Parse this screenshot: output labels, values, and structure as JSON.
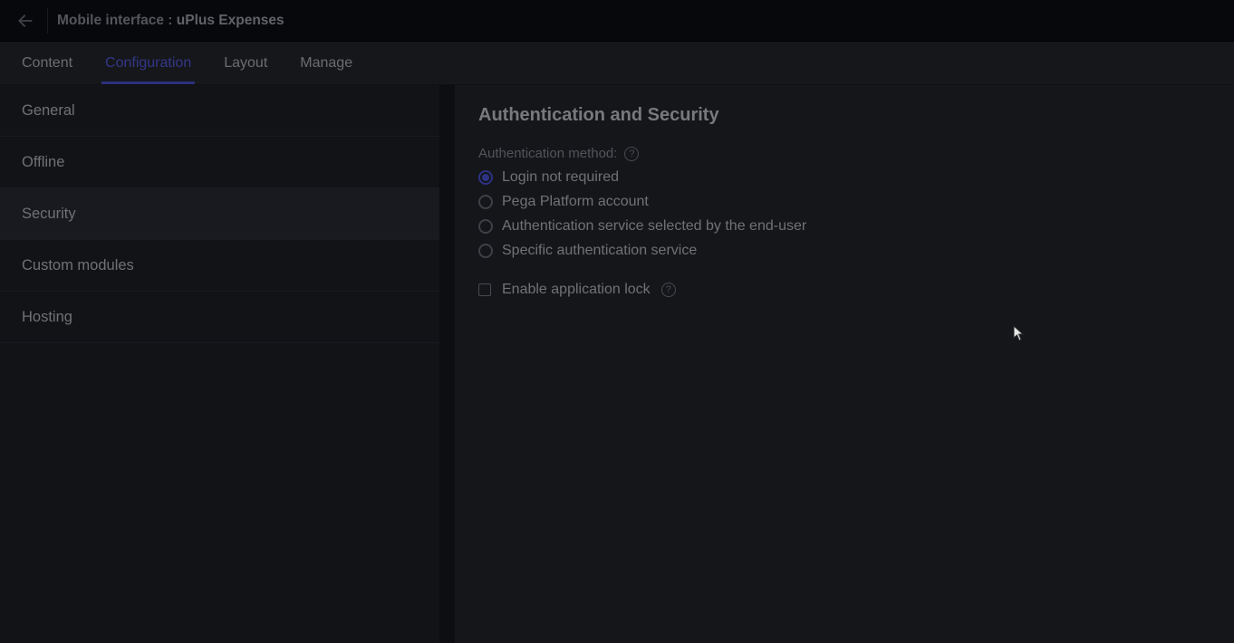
{
  "header": {
    "title_prefix": "Mobile interface :",
    "title_name": "uPlus Expenses"
  },
  "tabs": [
    {
      "label": "Content",
      "active": false
    },
    {
      "label": "Configuration",
      "active": true
    },
    {
      "label": "Layout",
      "active": false
    },
    {
      "label": "Manage",
      "active": false
    }
  ],
  "sidebar": {
    "items": [
      {
        "label": "General",
        "active": false
      },
      {
        "label": "Offline",
        "active": false
      },
      {
        "label": "Security",
        "active": true
      },
      {
        "label": "Custom modules",
        "active": false
      },
      {
        "label": "Hosting",
        "active": false
      }
    ]
  },
  "panel": {
    "title": "Authentication and Security",
    "auth_method_label": "Authentication method:",
    "auth_options": [
      {
        "label": "Login not required",
        "selected": true
      },
      {
        "label": "Pega Platform account",
        "selected": false
      },
      {
        "label": "Authentication service selected by the end-user",
        "selected": false
      },
      {
        "label": "Specific authentication service",
        "selected": false
      }
    ],
    "app_lock_label": "Enable application lock",
    "app_lock_checked": false
  },
  "icons": {
    "back": "arrow-left",
    "help": "?"
  }
}
